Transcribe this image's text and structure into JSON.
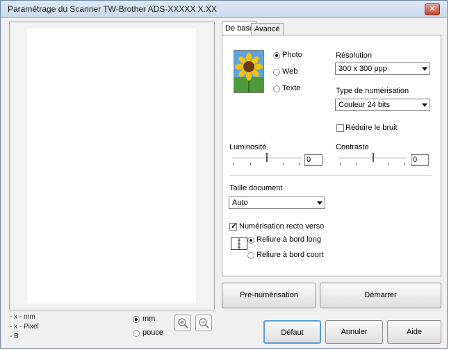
{
  "window": {
    "title": "Paramétrage du Scanner TW-Brother ADS-XXXXX X.XX",
    "close_icon": "close-icon"
  },
  "preview": {
    "info": [
      "- x - mm",
      "- x - Pixel",
      "- B"
    ],
    "units": [
      {
        "label": "mm",
        "selected": true
      },
      {
        "label": "pouce",
        "selected": false
      }
    ]
  },
  "tabs": [
    {
      "label": "De base",
      "active": true
    },
    {
      "label": "Avancé",
      "active": false
    }
  ],
  "basic": {
    "image_types": [
      {
        "label": "Photo",
        "selected": true
      },
      {
        "label": "Web",
        "selected": false
      },
      {
        "label": "Texte",
        "selected": false
      }
    ],
    "resolution": {
      "label": "Résolution",
      "value": "300 x 300 ppp"
    },
    "scan_type": {
      "label": "Type de numérisation",
      "value": "Couleur 24 bits"
    },
    "noise_reduction": {
      "label": "Réduire le bruit",
      "checked": false
    },
    "brightness": {
      "label": "Luminosité",
      "value": "0"
    },
    "contrast": {
      "label": "Contraste",
      "value": "0"
    },
    "document_size": {
      "label": "Taille document",
      "value": "Auto"
    },
    "duplex": {
      "label": "Numérisation recto verso",
      "checked": true,
      "bindings": [
        {
          "label": "Reliure à bord long",
          "selected": true
        },
        {
          "label": "Reliure à bord court",
          "selected": false
        }
      ]
    }
  },
  "buttons": {
    "prescan": "Pré-numérisation",
    "start": "Démarrer",
    "default": "Défaut",
    "cancel": "Annuler",
    "help": "Aide"
  },
  "colors": {
    "title_bar": "#c9d9ee",
    "close": "#c7432f",
    "accent": "#5b9bd5"
  }
}
